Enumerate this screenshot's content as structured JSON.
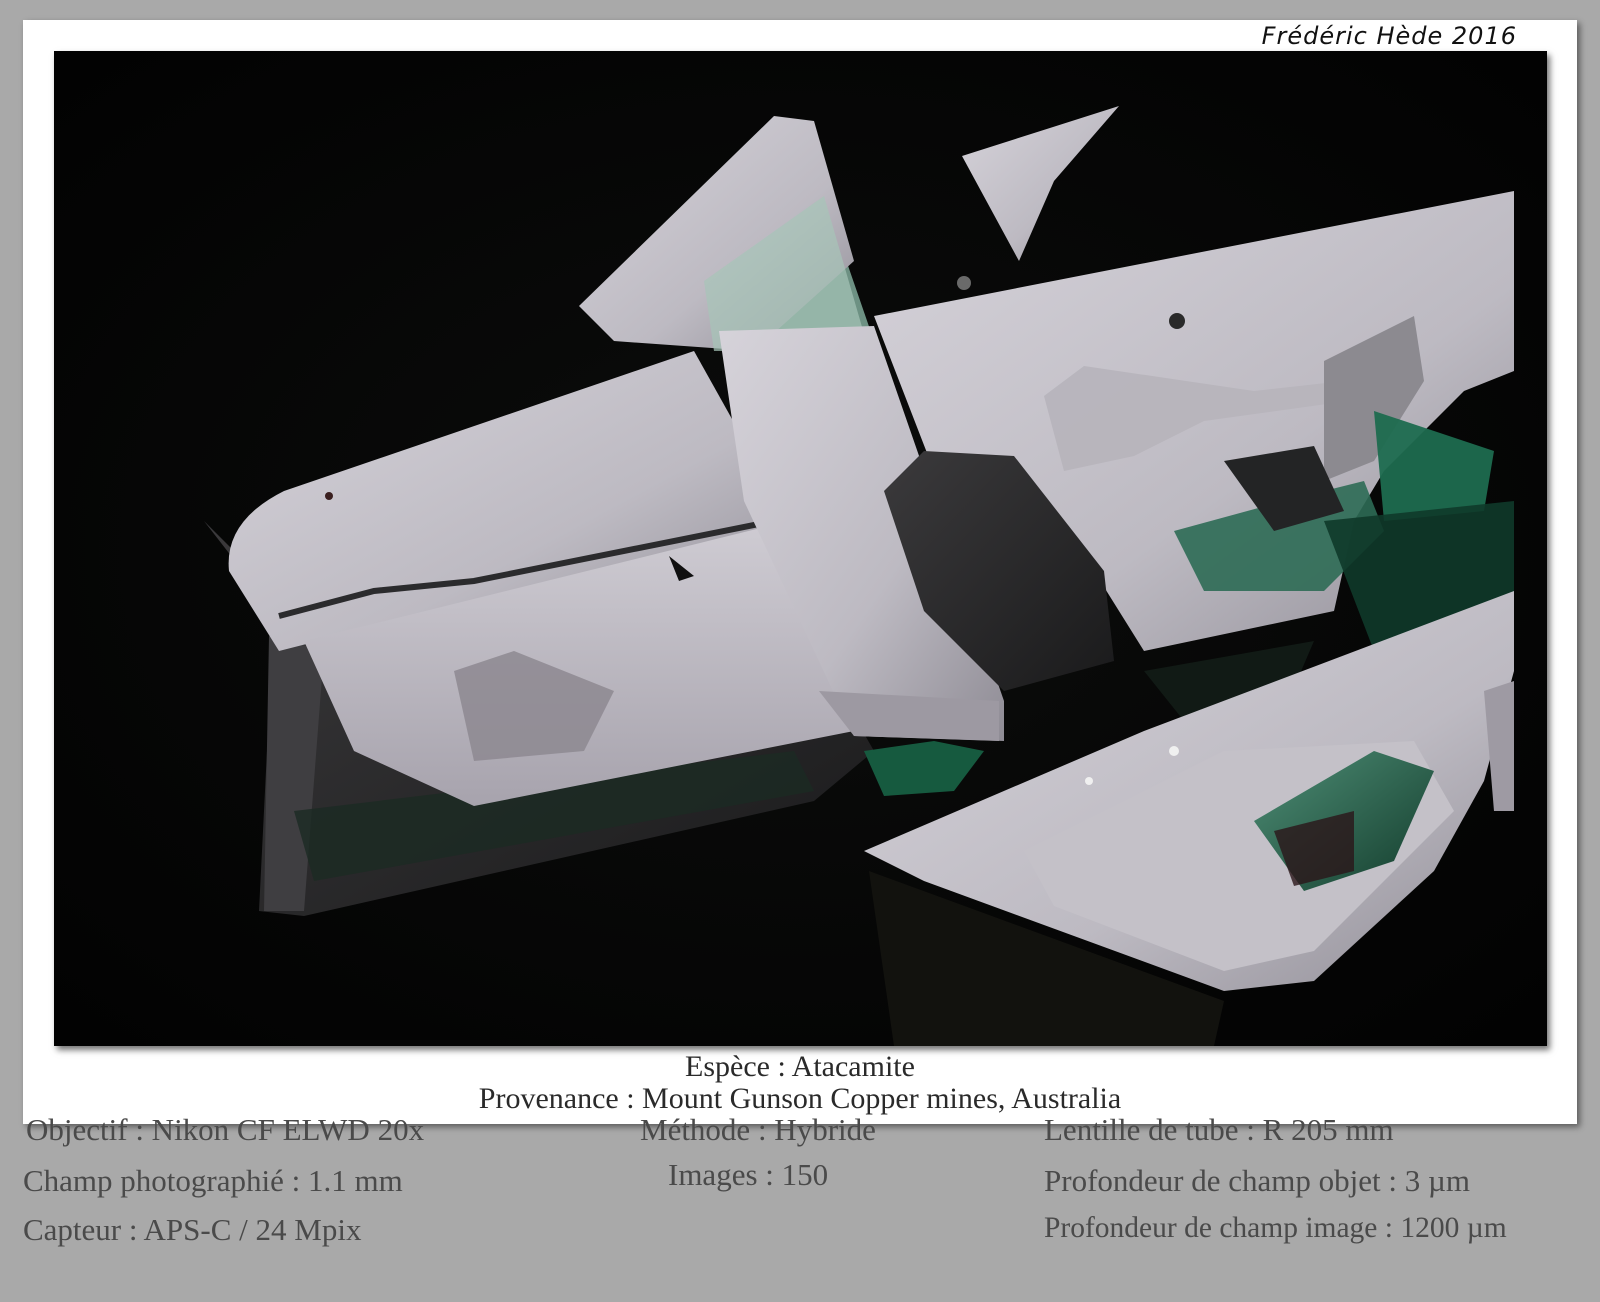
{
  "credit": "Frédéric Hède 2016",
  "caption": {
    "species": "Espèce : Atacamite",
    "provenance": "Provenance : Mount Gunson Copper mines, Australia"
  },
  "specs": {
    "objective": "Objectif : Nikon CF ELWD 20x",
    "field": "Champ photographié : 1.1 mm",
    "sensor": "Capteur : APS-C / 24 Mpix",
    "method": "Méthode : Hybride",
    "images": "Images : 150",
    "tube_lens": "Lentille de tube : R 205 mm",
    "dof_object": "Profondeur de champ objet : 3 µm",
    "dof_image": "Profondeur de champ image : 1200 µm"
  },
  "colors": {
    "crystal_face": "#c9c6cc",
    "crystal_green": "#1f5a44",
    "background": "#050605",
    "page_bg": "#a9a9a9"
  }
}
